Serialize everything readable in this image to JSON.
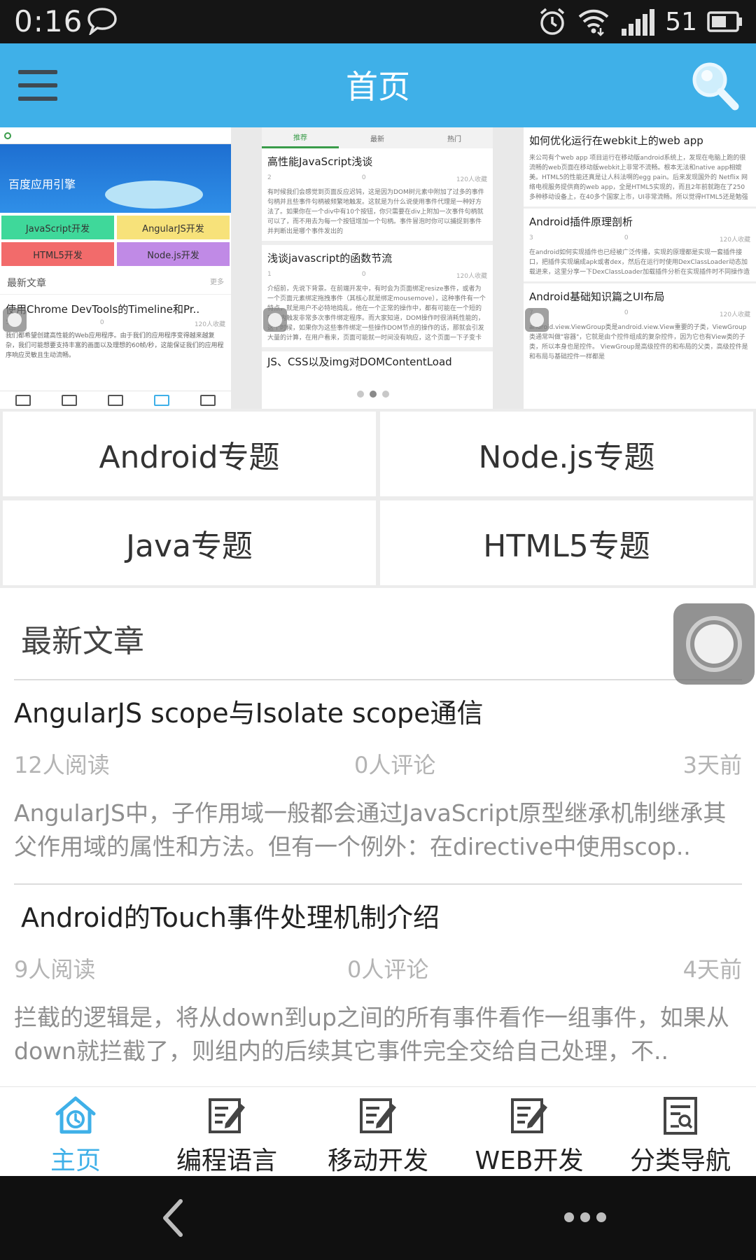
{
  "status_bar": {
    "time": "0:16",
    "battery": "51"
  },
  "app_bar": {
    "title": "首页"
  },
  "banner": {
    "slide1": {
      "hero_title": "百度应用引擎",
      "categories": [
        {
          "label": "JavaScript开发",
          "color": "#3fd89a"
        },
        {
          "label": "AngularJS开发",
          "color": "#f7e27a"
        },
        {
          "label": "HTML5开发",
          "color": "#f26b6b"
        },
        {
          "label": "Node.js开发",
          "color": "#c08ae6"
        }
      ],
      "section": "最新文章",
      "more": "更多",
      "article_title": "使用Chrome DevTools的Timeline和Pr..",
      "article_meta": [
        "5",
        "0",
        "120人收藏"
      ],
      "article_text": "我们都希望创建高性能的Web应用程序。由于我们的应用程序变得越来越复杂，我们可能想要支持丰富的画面以及理想的60帧/秒，这能保证我们的应用程序响应灵敏且生动流畅。"
    },
    "slide2": {
      "tabs": [
        "推荐",
        "最新",
        "热门"
      ],
      "posts": [
        {
          "title": "高性能JavaScript浅谈",
          "meta": [
            "2",
            "0",
            "120人收藏"
          ],
          "text": "有时候我们会感觉到页面反应迟钝，这是因为DOM树元素中附加了过多的事件句柄并且些事件句柄被频繁地触发。这就是为什么说使用事件代理是一种好方法了。如果你在一个div中有10个按钮，你只需要在div上附加一次事件句柄就可以了，而不用去为每一个按钮增加一个句柄。事件冒泡时你可以捕捉到事件并判断出是哪个事件发出的"
        },
        {
          "title": "浅谈javascript的函数节流",
          "meta": [
            "1",
            "0",
            "120人收藏"
          ],
          "text": "介绍前，先说下背景。在前端开发中，有时会为页面绑定resize事件，或者为一个页面元素绑定拖拽事件（其核心就是绑定mousemove），这种事件有一个特点，就是用户不必特地捣乱，他在一个正常的操作中，都有可能在一个短的时间内触发非常多次事件绑定程序。而大家知道，DOM操作时很消耗性能的，这个时候，如果你为这些事件绑定一些操作DOM节点的操作的话，那就会引发大量的计算，在用户看来，页面可能就一时间没有响应，这个页面一下子变卡了变慢了。甚至在IE下，如果你绑定的resize事件进行较多DOM操作，其高频率可能直接就使得浏览器崩溃。"
        }
      ],
      "next_title": "JS、CSS以及img对DOMContentLoad"
    },
    "slide3": {
      "posts": [
        {
          "title": "如何优化运行在webkit上的web app",
          "meta": [
            "3",
            "0",
            "120人收藏"
          ],
          "text": "来公司有个web app 项目运行在移动版android系统上，发现在电脑上跑的很流畅的web页面在移动版webkit上非常不流畅。根本无法和native app相媲美。HTML5的性能还真是让人科法啊的egg pain。后来发现国外的 Netflix 网络电视服务提供商的web app，全是HTML5实现的，而且2年前就跑在了250多种移动设备上，在40多个国家上市，UI非常流畅。所以觉得HTML5还是勉强有救的。"
        },
        {
          "title": "Android插件原理剖析",
          "meta": [
            "3",
            "0",
            "120人收藏"
          ],
          "text": "在android如何实现插件也已经被广泛传播，实现的原理都是实现一套插件接口，把插件实现编成apk或者dex，然后在运行时使用DexClassLoader动态加载进来，这里分享一下DexClassLoader加载插件分析在实现插件时不同操作造成错误的原因。"
        },
        {
          "title": "Android基础知识篇之UI布局",
          "meta": [
            "7",
            "0",
            "120人收藏"
          ],
          "text": "android.view.ViewGroup类是android.view.View重要的子类，ViewGroup类通常叫做\"容器\"，它就是由个控件组成的复杂控件，因为它也有View类的子类，所以本身也是控件。 ViewGroup是高级控件的和布局的父类，高级控件是和布局与基础控件一样都是"
        }
      ]
    }
  },
  "topics": [
    {
      "label": "Android专题"
    },
    {
      "label": "Node.js专题"
    },
    {
      "label": "Java专题"
    },
    {
      "label": "HTML5专题"
    }
  ],
  "latest": {
    "title": "最新文章",
    "articles": [
      {
        "title": "AngularJS scope与Isolate scope通信",
        "reads": "12人阅读",
        "comments": "0人评论",
        "time": "3天前",
        "summary": "AngularJS中，子作用域一般都会通过JavaScript原型继承机制继承其父作用域的属性和方法。但有一个例外：在directive中使用scop.."
      },
      {
        "title": "Android的Touch事件处理机制介绍",
        "reads": "9人阅读",
        "comments": "0人评论",
        "time": "4天前",
        "summary": "拦截的逻辑是，将从down到up之间的所有事件看作一组事件，如果从down就拦截了，则组内的后续其它事件完全交给自己处理，不.."
      }
    ]
  },
  "tab_bar": {
    "accent": "#3fb0e8",
    "tabs": [
      {
        "label": "主页",
        "icon": "home-icon",
        "active": true
      },
      {
        "label": "编程语言",
        "icon": "edit-document-icon",
        "active": false
      },
      {
        "label": "移动开发",
        "icon": "edit-document-icon",
        "active": false
      },
      {
        "label": "WEB开发",
        "icon": "edit-document-icon",
        "active": false
      },
      {
        "label": "分类导航",
        "icon": "category-list-icon",
        "active": false
      }
    ]
  },
  "colors": {
    "app_bar": "#3fb0e8",
    "status_bar": "#151515",
    "nav_bar": "#101010"
  }
}
